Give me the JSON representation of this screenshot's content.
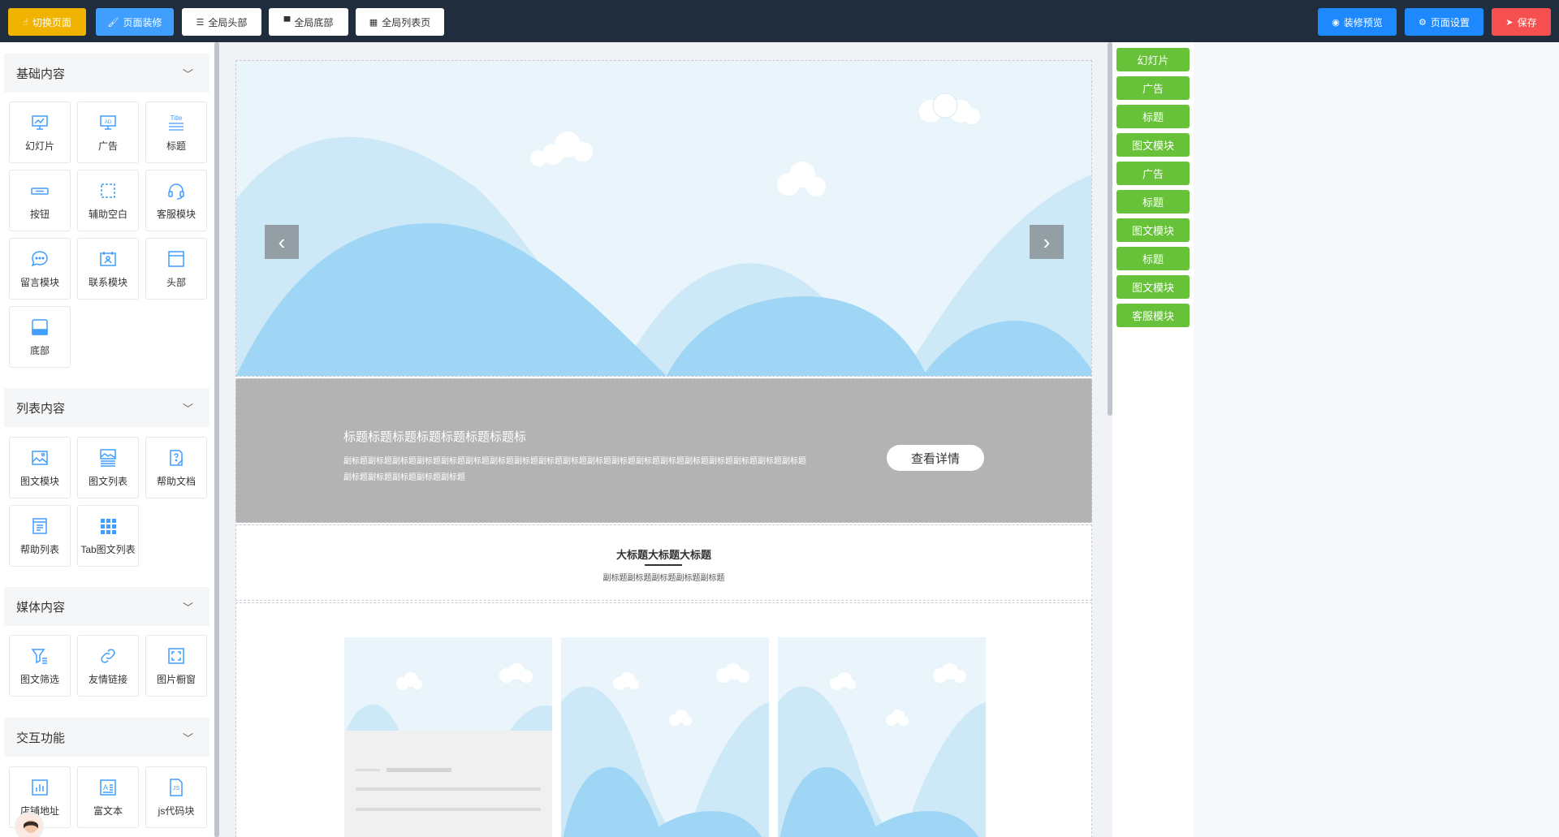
{
  "topbar": {
    "switch_page": "切换页面",
    "page_decor": "页面装修",
    "global_header": "全局头部",
    "global_footer": "全局底部",
    "global_list": "全局列表页",
    "preview": "装修预览",
    "page_settings": "页面设置",
    "save": "保存"
  },
  "sections": {
    "basic": {
      "title": "基础内容",
      "items": [
        "幻灯片",
        "广告",
        "标题",
        "按钮",
        "辅助空白",
        "客服模块",
        "留言模块",
        "联系模块",
        "头部",
        "底部"
      ]
    },
    "list": {
      "title": "列表内容",
      "items": [
        "图文模块",
        "图文列表",
        "帮助文档",
        "帮助列表",
        "Tab图文列表"
      ]
    },
    "media": {
      "title": "媒体内容",
      "items": [
        "图文筛选",
        "友情链接",
        "图片橱窗"
      ]
    },
    "interactive": {
      "title": "交互功能",
      "items": [
        "店铺地址",
        "富文本",
        "js代码块"
      ]
    }
  },
  "canvas": {
    "ad": {
      "title": "标题标题标题标题标题标题标题标",
      "subtitle": "副标题副标题副标题副标题副标题副标题副标题副标题副标题副标题副标题副标题副标题副标题副标题副标题副标题副标题副标题副标题副标题副标题副标题副标题",
      "button": "查看详情"
    },
    "title_module": {
      "title": "大标题大标题大标题",
      "subtitle": "副标题副标题副标题副标题副标题"
    }
  },
  "layers": [
    "幻灯片",
    "广告",
    "标题",
    "图文模块",
    "广告",
    "标题",
    "图文模块",
    "标题",
    "图文模块",
    "客服模块"
  ],
  "colors": {
    "topbar": "#1f2d3d",
    "accent_blue": "#409eff",
    "layer_green": "#67c23a",
    "save_red": "#f54f4f",
    "switch_yellow": "#f0b400"
  }
}
